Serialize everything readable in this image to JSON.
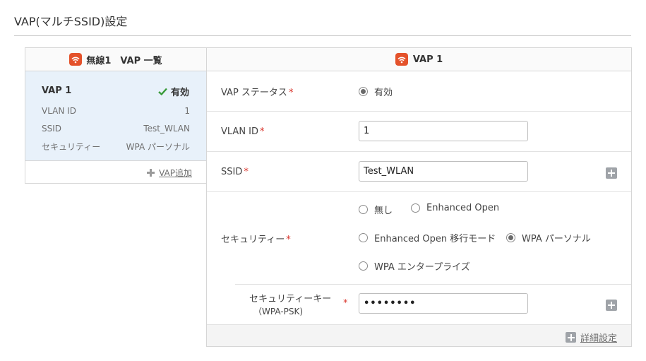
{
  "page": {
    "title": "VAP(マルチSSID)設定"
  },
  "colors": {
    "wifi_icon": "#e4522b",
    "status_check": "#3a9b3a",
    "required_mark": "#d9342b",
    "card_bg": "#e8f1fa"
  },
  "left_panel": {
    "header": "無線1　VAP 一覧",
    "header_icon": "wifi-icon",
    "vap": {
      "name": "VAP 1",
      "status": "有効",
      "status_icon": "check-icon",
      "rows": [
        {
          "label": "VLAN ID",
          "value": "1"
        },
        {
          "label": "SSID",
          "value": "Test_WLAN"
        },
        {
          "label": "セキュリティー",
          "value": "WPA パーソナル"
        }
      ]
    },
    "add_label": "VAP追加",
    "add_icon": "plus-icon"
  },
  "right_panel": {
    "header": "VAP 1",
    "header_icon": "wifi-icon",
    "status": {
      "label": "VAP ステータス",
      "required": "*",
      "option": "有効",
      "checked": true
    },
    "vlan": {
      "label": "VLAN ID",
      "required": "*",
      "value": "1"
    },
    "ssid": {
      "label": "SSID",
      "required": "*",
      "value": "Test_WLAN",
      "add_icon": "plus-box-icon"
    },
    "security": {
      "label": "セキュリティー",
      "required": "*",
      "options": [
        {
          "label": "無し",
          "checked": false
        },
        {
          "label": "Enhanced Open",
          "checked": false
        },
        {
          "label": "Enhanced Open 移行モード",
          "checked": false
        },
        {
          "label": "WPA パーソナル",
          "checked": true
        },
        {
          "label": "WPA エンタープライズ",
          "checked": false
        }
      ]
    },
    "key": {
      "label_line1": "セキュリティーキー",
      "label_line2": "（WPA-PSK)",
      "required": "*",
      "value": "••••••••",
      "add_icon": "plus-box-icon"
    },
    "detail_label": "詳細設定",
    "detail_icon": "plus-box-icon"
  }
}
